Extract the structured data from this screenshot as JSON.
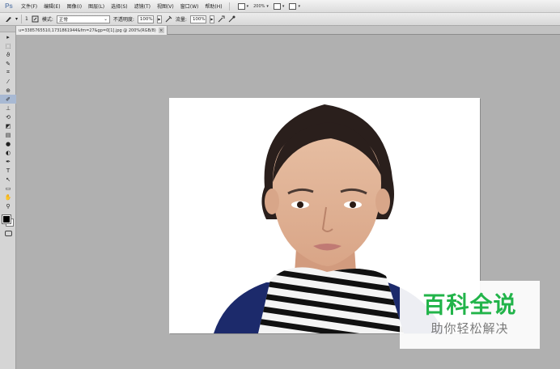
{
  "app": {
    "logo": "Ps"
  },
  "menu": {
    "items": [
      "文件(F)",
      "编辑(E)",
      "图像(I)",
      "图层(L)",
      "选择(S)",
      "滤镜(T)",
      "视图(V)",
      "窗口(W)",
      "帮助(H)"
    ],
    "zoom": "200%"
  },
  "options": {
    "brush_size": "1",
    "mode_label": "模式:",
    "mode_value": "正常",
    "opacity_label": "不透明度:",
    "opacity_value": "100%",
    "flow_label": "流量:",
    "flow_value": "100%"
  },
  "document": {
    "tab_title": "u=3385765510,1731861944&fm=27&gp=0[1].jpg @ 200%(RGB/8)",
    "close": "×"
  },
  "watermark": {
    "title": "百科全说",
    "subtitle": "助你轻松解决",
    "color": "#22b44a"
  },
  "tools": [
    "move-icon",
    "marquee-icon",
    "lasso-icon",
    "quick-select-icon",
    "crop-icon",
    "eyedropper-icon",
    "healing-icon",
    "brush-icon",
    "stamp-icon",
    "history-brush-icon",
    "eraser-icon",
    "gradient-icon",
    "blur-icon",
    "dodge-icon",
    "pen-icon",
    "type-icon",
    "path-select-icon",
    "shape-icon",
    "hand-icon",
    "zoom-icon"
  ]
}
